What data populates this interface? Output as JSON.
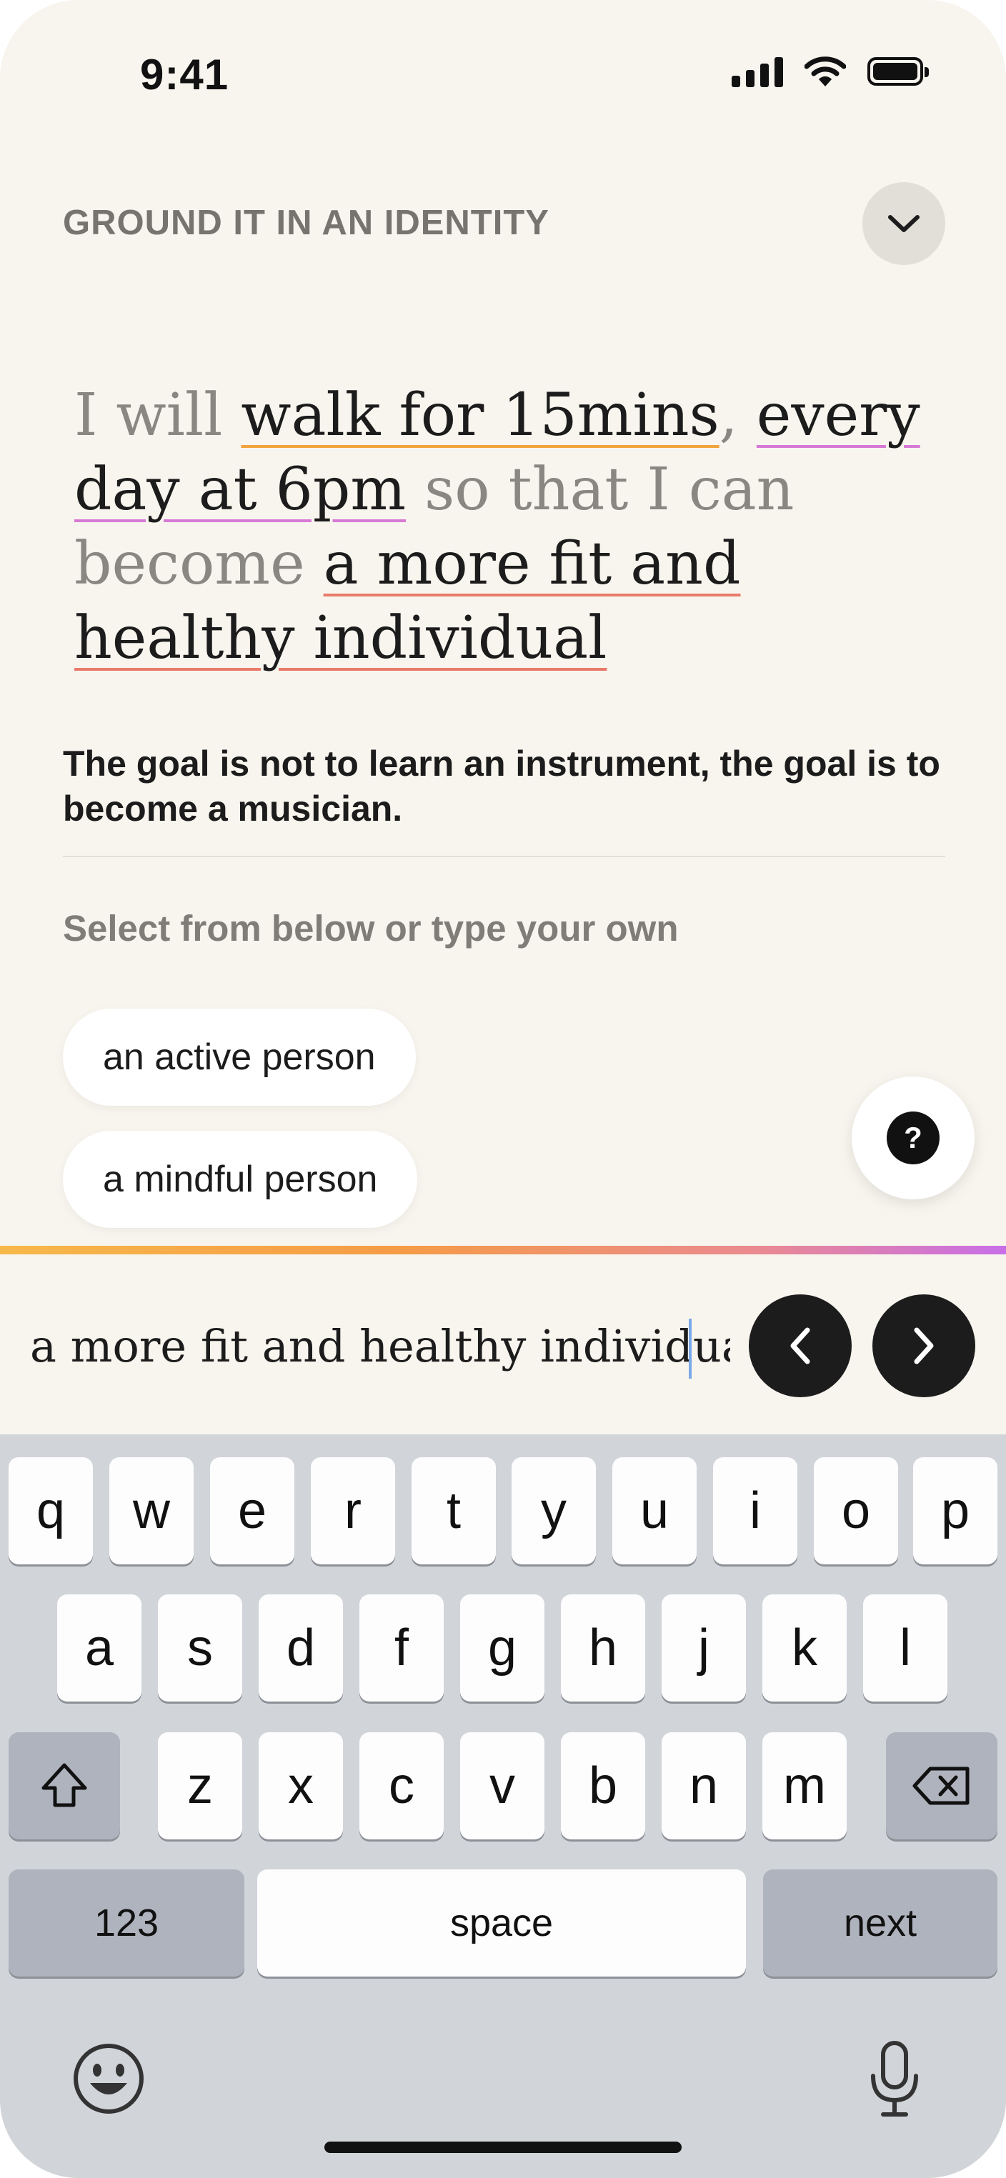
{
  "status_bar": {
    "time": "9:41"
  },
  "header": {
    "title": "GROUND IT IN AN IDENTITY"
  },
  "sentence": {
    "intro": "I will ",
    "action": "walk for 15mins",
    "comma": ", ",
    "frequency": "every day at 6pm",
    "middle": " so that I can become ",
    "identity": "a more fit and healthy individual"
  },
  "quote": "The goal is not to learn an instrument, the goal is to become a musician.",
  "suggestions": {
    "label": "Select from below or type your own",
    "options": [
      "an active person",
      "a mindful person"
    ]
  },
  "help_button": {
    "label": "?"
  },
  "input": {
    "value": "a more fit and healthy individual"
  },
  "keyboard": {
    "row1": [
      "q",
      "w",
      "e",
      "r",
      "t",
      "y",
      "u",
      "i",
      "o",
      "p"
    ],
    "row2": [
      "a",
      "s",
      "d",
      "f",
      "g",
      "h",
      "j",
      "k",
      "l"
    ],
    "row3": [
      "z",
      "x",
      "c",
      "v",
      "b",
      "n",
      "m"
    ],
    "numbers_label": "123",
    "space_label": "space",
    "next_label": "next"
  },
  "colors": {
    "background": "#f8f5ee",
    "accent_gradient": [
      "#f7b84a",
      "#ea8a90",
      "#c86ee8"
    ],
    "dark_button": "#1c1c1c"
  },
  "icons": [
    "cellular-signal-icon",
    "wifi-icon",
    "battery-icon",
    "chevron-down-icon",
    "question-icon",
    "chevron-left-icon",
    "chevron-right-icon",
    "shift-icon",
    "backspace-icon",
    "emoji-icon",
    "microphone-icon"
  ]
}
